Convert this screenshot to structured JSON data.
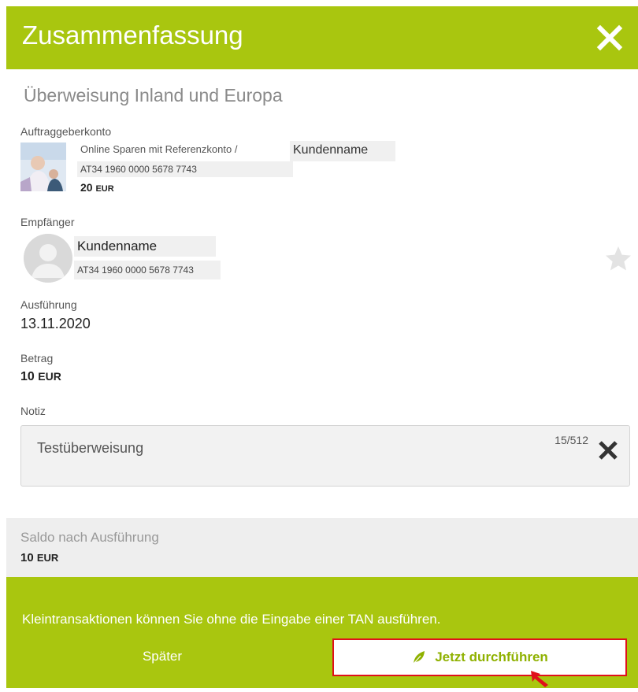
{
  "header": {
    "title": "Zusammenfassung",
    "close_icon": "close-icon"
  },
  "section_title": "Überweisung Inland und Europa",
  "sender": {
    "label": "Auftraggeberkonto",
    "account_name": "Online Sparen mit Referenzkonto /",
    "customer_name": "Kundenname",
    "iban": "AT34 1960 0000 5678 7743",
    "balance_amount": "20",
    "balance_currency": "EUR"
  },
  "recipient": {
    "label": "Empfänger",
    "name": "Kundenname",
    "iban": "AT34 1960 0000 5678 7743",
    "favorite_icon": "star-icon"
  },
  "execution": {
    "label": "Ausführung",
    "date": "13.11.2020"
  },
  "amount": {
    "label": "Betrag",
    "value": "10",
    "currency": "EUR"
  },
  "note": {
    "label": "Notiz",
    "value": "Testüberweisung",
    "counter": "15/512"
  },
  "saldo": {
    "label": "Saldo nach Ausführung",
    "value": "10",
    "currency": "EUR"
  },
  "footer": {
    "info": "Kleintransaktionen können Sie ohne die Eingabe einer TAN ausführen.",
    "later_label": "Später",
    "execute_label": "Jetzt durchführen"
  },
  "colors": {
    "brand_green": "#a9c60f",
    "highlight_red": "#e0101a"
  }
}
